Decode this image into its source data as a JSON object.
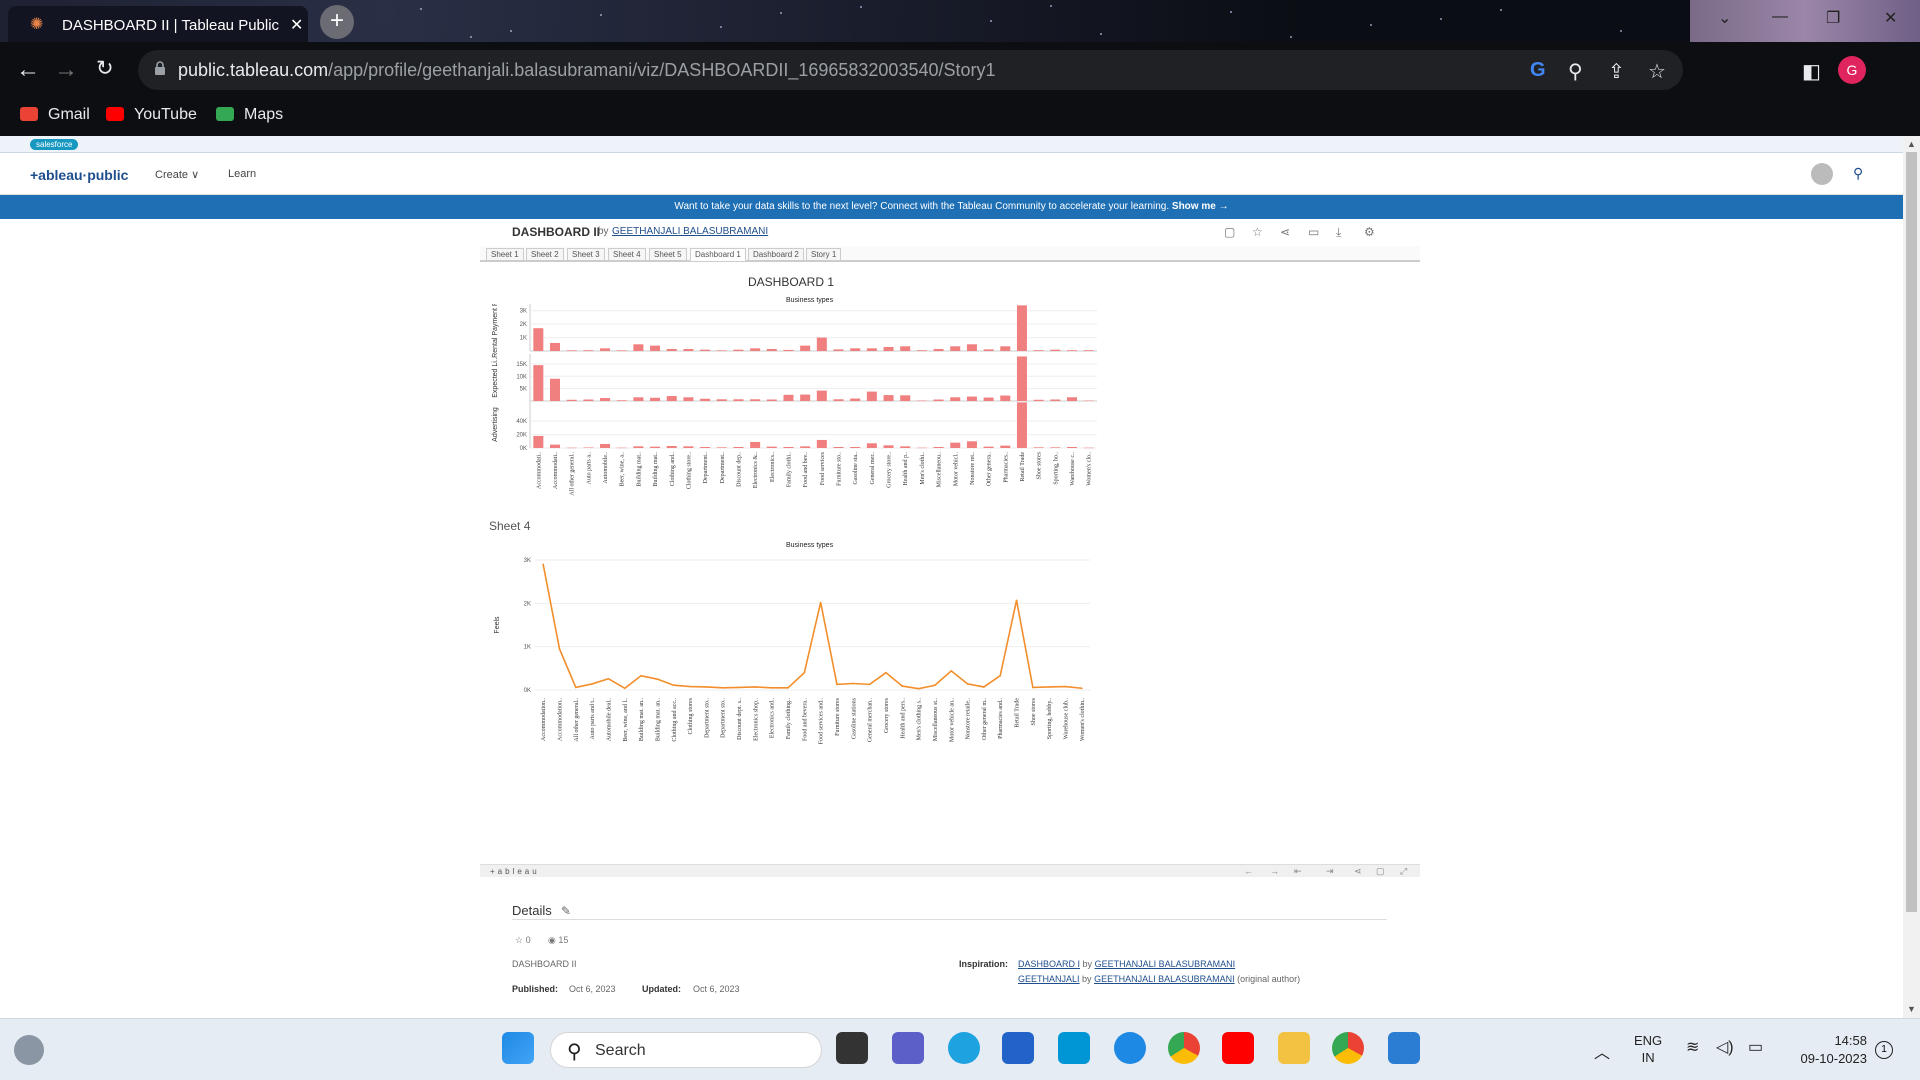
{
  "browser": {
    "tab_title": "DASHBOARD II | Tableau Public",
    "new_tab_label": "+",
    "url_host": "public.tableau.com",
    "url_path": "/app/profile/geethanjali.balasubramani/viz/DASHBOARDII_16965832003540/Story1",
    "profile_initial": "G",
    "bookmarks": [
      {
        "label": "Gmail",
        "color": "#ea4335"
      },
      {
        "label": "YouTube",
        "color": "#ff0000"
      },
      {
        "label": "Maps",
        "color": "#34a853"
      }
    ]
  },
  "site": {
    "salesforce_label": "salesforce",
    "logo": "+ableau·public",
    "nav_create": "Create ∨",
    "nav_learn": "Learn",
    "banner_text": "Want to take your data skills to the next level? Connect with the Tableau Community to accelerate your learning.",
    "banner_link": "Show me →"
  },
  "viz": {
    "title": "DASHBOARD II",
    "by": "by",
    "author": "GEETHANJALI BALASUBRAMANI",
    "tabs": [
      "Sheet 1",
      "Sheet 2",
      "Sheet 3",
      "Sheet 4",
      "Sheet 5",
      "Dashboard 1",
      "Dashboard 2",
      "Story 1"
    ],
    "active_tab": "Dashboard 1",
    "dashboard_title": "DASHBOARD 1",
    "sheet4_title": "Sheet 4",
    "footer_logo": "+ableau"
  },
  "chart_data": [
    {
      "type": "bar",
      "title": "Business types",
      "panels": [
        "Rental Payment R..",
        "Expected Li..",
        "Advertising"
      ],
      "colors": {
        "bar": "#f08080"
      },
      "categories": [
        "Accommodati..",
        "Accommodati..",
        "All other general..",
        "Auto parts a..",
        "Automobile..",
        "Beer, wine, a..",
        "Building mat..",
        "Building mat..",
        "Clothing and..",
        "Clothing store..",
        "Department..",
        "Department..",
        "Discount dep..",
        "Electronics &..",
        "Electronics..",
        "Family clothi..",
        "Food and bev..",
        "Food services",
        "Furniture sto..",
        "Gasoline sta..",
        "General mer..",
        "Grocery store..",
        "Health and p..",
        "Men's clothi..",
        "Miscellaneou..",
        "Motor vehicl..",
        "Nonstore ret..",
        "Other genera..",
        "Pharmacies..",
        "Retail Trade",
        "Shoe stores",
        "Sporting, ho..",
        "Warehouse c..",
        "Women's clo.."
      ],
      "series": [
        {
          "name": "Rental Payment R..",
          "ylim": [
            0,
            3500
          ],
          "ticks": [
            "3K",
            "2K",
            "1K"
          ],
          "values": [
            1700,
            600,
            50,
            60,
            200,
            50,
            500,
            400,
            150,
            150,
            100,
            50,
            100,
            200,
            150,
            80,
            400,
            1000,
            120,
            200,
            200,
            300,
            350,
            60,
            150,
            350,
            500,
            120,
            350,
            3400,
            60,
            100,
            60,
            60
          ]
        },
        {
          "name": "Expected Li..",
          "ylim": [
            0,
            19000
          ],
          "ticks": [
            "15K",
            "10K",
            "5K"
          ],
          "values": [
            14500,
            9000,
            500,
            600,
            1200,
            300,
            1500,
            1300,
            2000,
            1500,
            900,
            700,
            700,
            700,
            600,
            2500,
            2600,
            4200,
            700,
            1000,
            3800,
            2400,
            2300,
            200,
            600,
            1500,
            1800,
            1400,
            2200,
            18000,
            500,
            600,
            1500,
            200
          ]
        },
        {
          "name": "Advertising",
          "ylim": [
            0,
            70000
          ],
          "ticks": [
            "40K",
            "20K",
            "0K"
          ],
          "values": [
            18000,
            5000,
            500,
            800,
            6000,
            500,
            2500,
            2000,
            3000,
            2500,
            1500,
            1000,
            1500,
            9000,
            2000,
            1500,
            2500,
            12000,
            1500,
            1500,
            7000,
            4000,
            2500,
            500,
            1500,
            8000,
            10000,
            2000,
            3500,
            68000,
            1000,
            1000,
            1500,
            500
          ]
        }
      ]
    },
    {
      "type": "line",
      "title": "Business types",
      "ylabel": "Feels",
      "colors": {
        "line": "#f28e2b"
      },
      "ylim": [
        0,
        3000
      ],
      "yticks": [
        "3K",
        "2K",
        "1K",
        "0K"
      ],
      "categories": [
        "Accommodation..",
        "Accommodation..",
        "All other general..",
        "Auto parts and t..",
        "Automobile deal..",
        "Beer, wine, and l..",
        "Building mat. an..",
        "Building mat. an..",
        "Clothing and acc..",
        "Clothing stores",
        "Department sto..",
        "Department sto..",
        "Discount dept. s..",
        "Electronics shop..",
        "Electronics and..",
        "Family clothing..",
        "Food and bevera..",
        "Food services and..",
        "Furniture stores",
        "Gasoline stations",
        "General merchan..",
        "Grocery stores",
        "Health and pers..",
        "Men's clothing s..",
        "Miscellaneous st..",
        "Motor vehicle an..",
        "Nonstore retaile..",
        "Other general m..",
        "Pharmacies and..",
        "Retail Trade",
        "Shoe stores",
        "Sporting, hobby..",
        "Warehouse club..",
        "Women's clothin.."
      ],
      "values": [
        2900,
        950,
        60,
        140,
        260,
        40,
        330,
        250,
        110,
        80,
        70,
        50,
        60,
        70,
        50,
        50,
        400,
        2020,
        130,
        150,
        130,
        400,
        90,
        30,
        110,
        440,
        140,
        70,
        330,
        2070,
        60,
        70,
        80,
        40
      ]
    }
  ],
  "details": {
    "label": "Details",
    "star_count": "0",
    "view_count": "15",
    "viz_name": "DASHBOARD II",
    "published_label": "Published:",
    "published_value": "Oct 6, 2023",
    "updated_label": "Updated:",
    "updated_value": "Oct 6, 2023",
    "inspiration_label": "Inspiration:",
    "insp1_link": "DASHBOARD I",
    "insp1_by": "by",
    "insp1_author": "GEETHANJALI BALASUBRAMANI",
    "insp2_link": "GEETHANJALI",
    "insp2_by": "by",
    "insp2_author": "GEETHANJALI BALASUBRAMANI",
    "insp2_note": "(original author)"
  },
  "taskbar": {
    "search_placeholder": "Search",
    "lang_top": "ENG",
    "lang_bottom": "IN",
    "time": "14:58",
    "date": "09-10-2023",
    "notification_count": "1"
  }
}
